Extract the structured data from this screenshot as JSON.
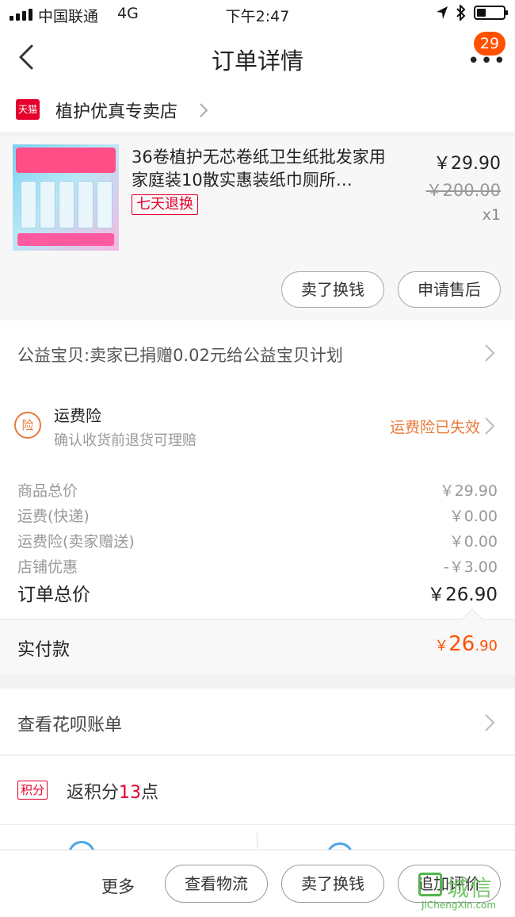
{
  "status_bar": {
    "carrier": "中国联通",
    "network": "4G",
    "time": "下午2:47"
  },
  "nav": {
    "title": "订单详情",
    "more_dots": "•••",
    "badge_count": "29"
  },
  "shop": {
    "platform_label": "天猫",
    "name": "植护优真专卖店"
  },
  "product": {
    "title": "36卷植护无芯卷纸卫生纸批发家用家庭装10散实惠装纸巾厕所…",
    "return_badge": "七天退换",
    "price": "￥29.90",
    "original_price": "￥200.00",
    "quantity": "x1",
    "actions": [
      "卖了换钱",
      "申请售后"
    ]
  },
  "charity": {
    "text": "公益宝贝:卖家已捐赠0.02元给公益宝贝计划"
  },
  "insurance": {
    "icon_label": "险",
    "title": "运费险",
    "subtitle": "确认收货前退货可理赔",
    "status": "运费险已失效",
    "status_color": "#e87a3a"
  },
  "summary": {
    "rows": [
      {
        "label": "商品总价",
        "value": "￥29.90"
      },
      {
        "label": "运费(快递)",
        "value": "￥0.00"
      },
      {
        "label": "运费险(卖家赠送)",
        "value": "￥0.00"
      },
      {
        "label": "店铺优惠",
        "value": "-￥3.00"
      }
    ],
    "total_label": "订单总价",
    "total_value": "￥26.90"
  },
  "paid": {
    "label": "实付款",
    "currency": "￥",
    "amount_int": "26",
    "amount_dec": ".90",
    "color": "#ff5000"
  },
  "huabei": {
    "text": "查看花呗账单"
  },
  "points": {
    "tag": "积分",
    "text_prefix": "返积分",
    "value": "13",
    "text_suffix": "点"
  },
  "bottom_bar": {
    "more": "更多",
    "buttons": [
      "查看物流",
      "卖了换钱",
      "追加评价"
    ]
  },
  "watermark": {
    "cn": "城信",
    "en": "JiChengXin.com"
  }
}
